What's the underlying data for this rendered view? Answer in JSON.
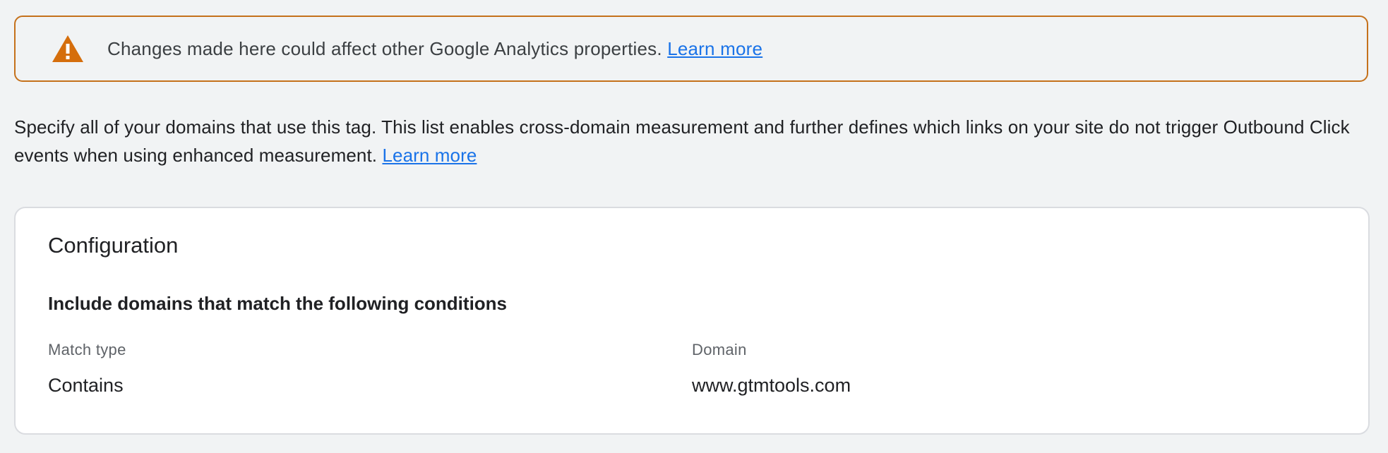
{
  "banner": {
    "icon": "warning-icon",
    "border_color": "#c5711b",
    "icon_color": "#d56e0c",
    "message": "Changes made here could affect other Google Analytics properties.",
    "link_text": "Learn more"
  },
  "description": {
    "text": "Specify all of your domains that use this tag. This list enables cross-domain measurement and further defines which links on your site do not trigger Outbound Click events when using enhanced measurement.",
    "link_text": "Learn more"
  },
  "configuration": {
    "title": "Configuration",
    "conditions_heading": "Include domains that match the following conditions",
    "match_type_label": "Match type",
    "match_type_value": "Contains",
    "domain_label": "Domain",
    "domain_value": "www.gtmtools.com"
  },
  "colors": {
    "link": "#1a73e8",
    "background": "#f1f3f4"
  }
}
